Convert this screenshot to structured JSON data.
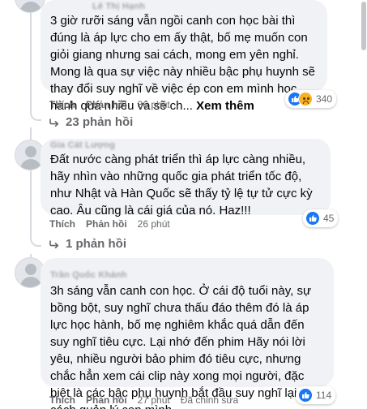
{
  "comments": [
    {
      "author": "Lê Thị Hạnh",
      "text": "3 giờ rưỡi sáng vẫn ngồi canh con học bài thì đúng là áp lực cho em ấy thật, bố mẹ muốn con giỏi giang nhưng sai cách, mong em yên nghỉ. Mong là qua sự việc này nhiều bậc phụ huynh sẽ thay đổi suy nghĩ về việc ép con em mình học hành quá nhiều và sẽ ch...",
      "see_more": "Xem thêm",
      "like_label": "Thích",
      "reply_label": "Phản hồi",
      "time": "36 phút",
      "reactions": [
        "like-icon",
        "sad-icon"
      ],
      "reaction_count": "340",
      "replies_label": "23 phản hồi"
    },
    {
      "author": "Gia Cát Lượng",
      "text": "Đất nước càng phát triển thì áp lực càng nhiều, hãy nhìn vào những quốc gia phát triển tốc độ, như Nhật và Hàn Quốc sẽ thấy tỷ lệ tự tử cực kỳ cao. Âu cũng là cái giá của nó. Haz!!!",
      "like_label": "Thích",
      "reply_label": "Phản hồi",
      "time": "26 phút",
      "reactions": [
        "like-icon"
      ],
      "reaction_count": "45",
      "replies_label": "1 phản hồi"
    },
    {
      "author": "Trần Quốc Khánh",
      "text": "3h sáng vẫn canh con học. Ở cái độ tuổi này, sự bồng bột, suy nghĩ chưa thấu đáo thêm đó là áp lực học hành, bố mẹ nghiêm khắc quá dẫn đến suy nghĩ tiêu cực. Lại nhớ đến phim Hãy nói lời yêu, nhiều người bảo phim đó tiêu cực, nhưng chắc hẳn xem cái clip này xong mọi người, đặc biệt là các bậc phụ huynh bắt đầu suy nghĩ lại cách quản lý con mình.",
      "like_label": "Thích",
      "reply_label": "Phản hồi",
      "time": "27 phút",
      "edited_label": "Đã chỉnh sửa",
      "reactions": [
        "like-icon"
      ],
      "reaction_count": "114"
    }
  ],
  "colors": {
    "bubble": "#f0f2f5",
    "meta": "#65676b",
    "like": "#1877f2",
    "sad": "#f7b125"
  }
}
